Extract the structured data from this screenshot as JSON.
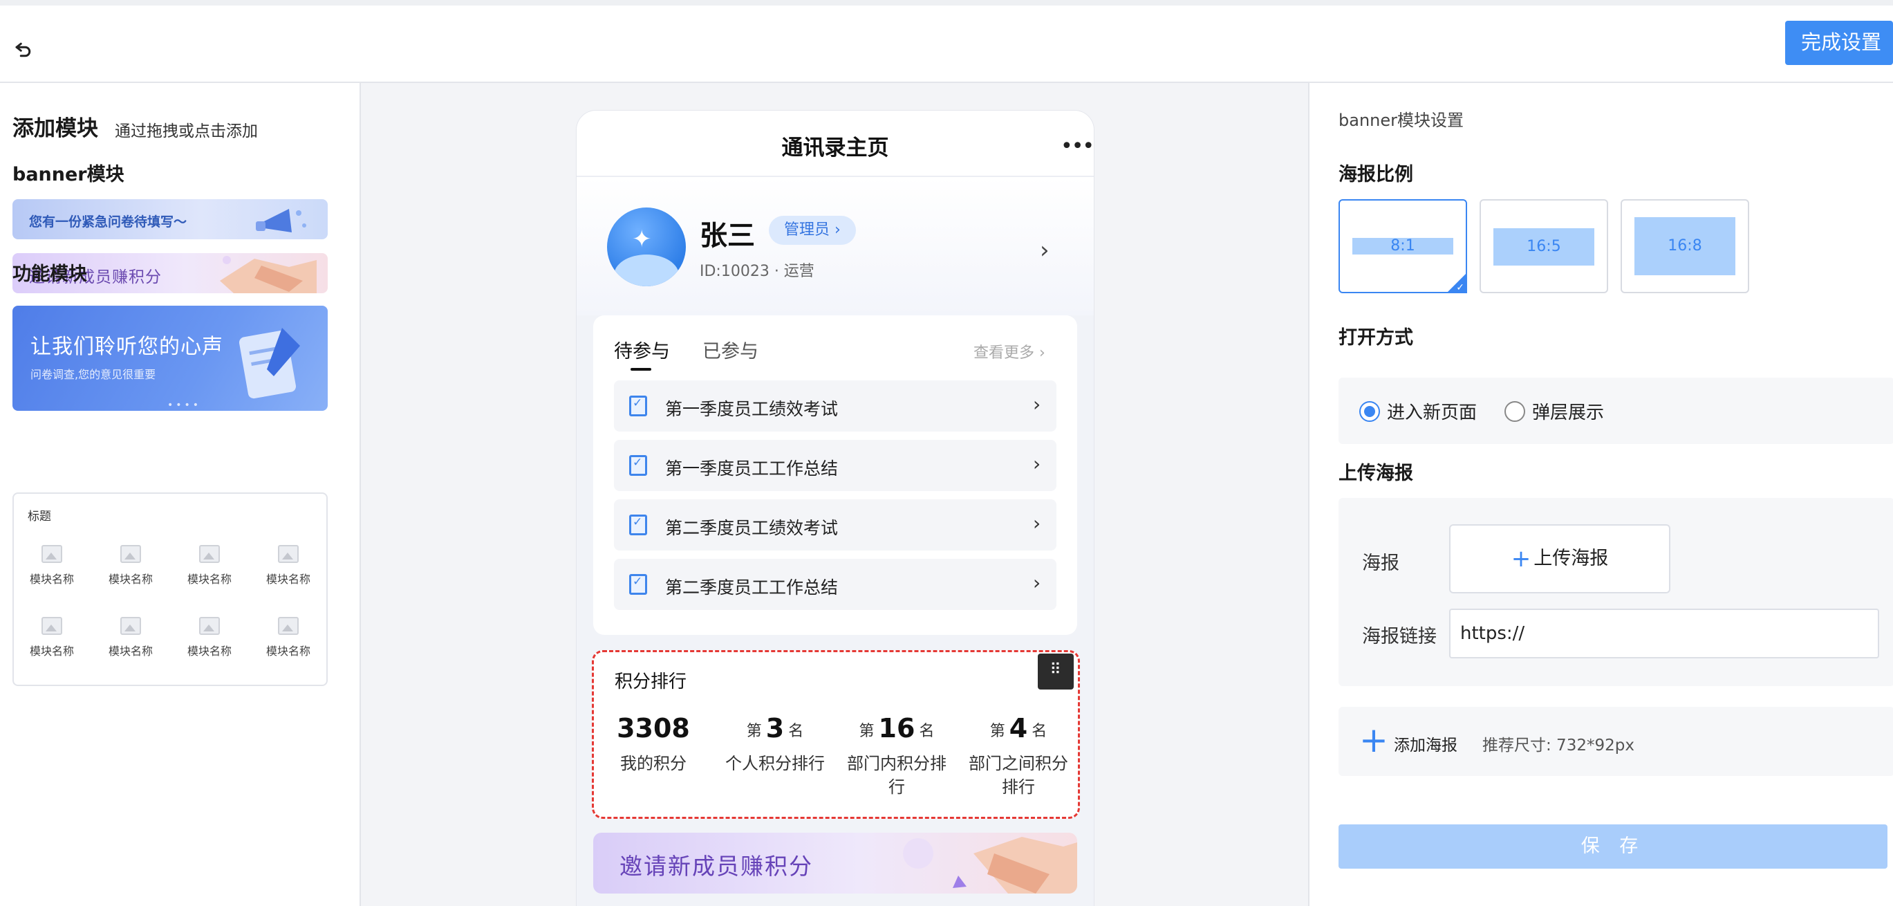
{
  "topbar": {
    "finish_label": "完成设置"
  },
  "left": {
    "title": "添加模块",
    "hint": "通过拖拽或点击添加",
    "banner_section": "banner模块",
    "banners": [
      {
        "text": "您有一份紧急问卷待填写～"
      },
      {
        "text": "邀请新成员赚积分"
      },
      {
        "title": "让我们聆听您的心声",
        "subtitle": "问卷调查,您的意见很重要"
      }
    ],
    "func_section": "功能模块",
    "func_box": {
      "title": "标题",
      "items": [
        "模块名称",
        "模块名称",
        "模块名称",
        "模块名称",
        "模块名称",
        "模块名称",
        "模块名称",
        "模块名称"
      ]
    }
  },
  "phone": {
    "title": "通讯录主页",
    "profile": {
      "name": "张三",
      "badge": "管理员 ›",
      "meta": "ID:10023 · 运营"
    },
    "tasks": {
      "tab_active": "待参与",
      "tab_other": "已参与",
      "see_more": "查看更多 ›",
      "items": [
        "第一季度员工绩效考试",
        "第一季度员工工作总结",
        "第二季度员工绩效考试",
        "第二季度员工工作总结"
      ]
    },
    "rank": {
      "title": "积分排行",
      "my_points": "3308",
      "my_points_label": "我的积分",
      "prefix": "第",
      "suffix": "名",
      "personal_rank": "3",
      "personal_label": "个人积分排行",
      "dept_rank": "16",
      "dept_label": "部门内积分排行",
      "inter_rank": "4",
      "inter_label": "部门之间积分排行"
    },
    "bottom_banner": "邀请新成员赚积分"
  },
  "right": {
    "header": "banner模块设置",
    "ratio_section": "海报比例",
    "ratios": [
      "8:1",
      "16:5",
      "16:8"
    ],
    "selected_ratio": "8:1",
    "open_section": "打开方式",
    "open_options": [
      "进入新页面",
      "弹层展示"
    ],
    "open_selected": "进入新页面",
    "upload_section": "上传海报",
    "poster_label": "海报",
    "upload_btn": "上传海报",
    "link_label": "海报链接",
    "link_value": "https://",
    "add_label": "添加海报",
    "size_hint": "推荐尺寸: 732*92px",
    "save_label": "保 存"
  },
  "colors": {
    "accent": "#3e8df4",
    "save_disabled": "#a9cdfb",
    "drag_outline": "#e53935"
  }
}
